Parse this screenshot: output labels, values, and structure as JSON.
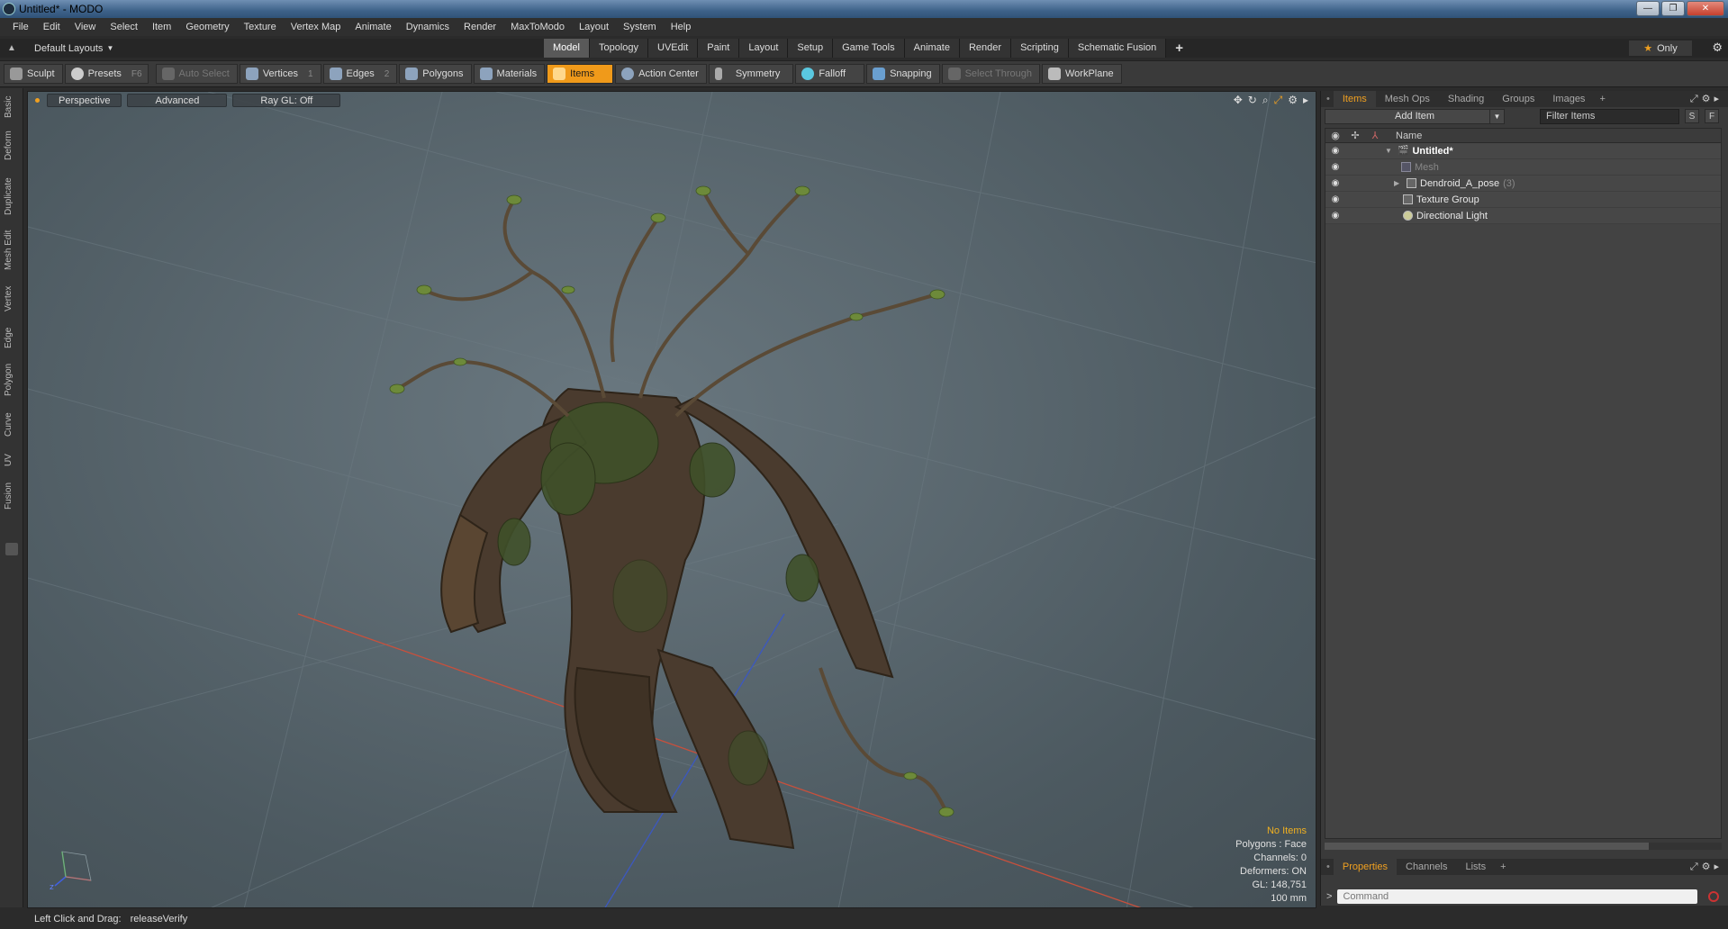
{
  "window": {
    "title": "Untitled* - MODO",
    "controls": [
      "—",
      "❐",
      "✕"
    ]
  },
  "menu": [
    "File",
    "Edit",
    "View",
    "Select",
    "Item",
    "Geometry",
    "Texture",
    "Vertex Map",
    "Animate",
    "Dynamics",
    "Render",
    "MaxToModo",
    "Layout",
    "System",
    "Help"
  ],
  "layout_selector": {
    "label": "Default Layouts"
  },
  "mode_tabs": [
    {
      "label": "Model",
      "active": true
    },
    {
      "label": "Topology"
    },
    {
      "label": "UVEdit"
    },
    {
      "label": "Paint"
    },
    {
      "label": "Layout"
    },
    {
      "label": "Setup"
    },
    {
      "label": "Game Tools"
    },
    {
      "label": "Animate"
    },
    {
      "label": "Render"
    },
    {
      "label": "Scripting"
    },
    {
      "label": "Schematic Fusion"
    }
  ],
  "mode_tabs_plus": "+",
  "only_button": {
    "star": "★",
    "label": "Only"
  },
  "toolbar": {
    "sculpt": "Sculpt",
    "presets": "Presets",
    "presets_hotkey": "F6",
    "auto_select": "Auto Select",
    "vertices": "Vertices",
    "vertices_hotkey": "1",
    "edges": "Edges",
    "edges_hotkey": "2",
    "polygons": "Polygons",
    "materials": "Materials",
    "items": "Items",
    "action_center": "Action Center",
    "symmetry": "Symmetry",
    "falloff": "Falloff",
    "snapping": "Snapping",
    "select_through": "Select Through",
    "workplane": "WorkPlane"
  },
  "left_tabs": [
    "Basic",
    "Deform",
    "Duplicate",
    "Mesh Edit",
    "Vertex",
    "Edge",
    "Polygon",
    "Curve",
    "UV",
    "Fusion"
  ],
  "viewport": {
    "view": "Perspective",
    "style": "Advanced",
    "raygl": "Ray GL: Off",
    "info": {
      "no_items": "No Items",
      "polygons": "Polygons : Face",
      "channels": "Channels: 0",
      "deformers": "Deformers: ON",
      "gl": "GL: 148,751",
      "scale": "100 mm"
    }
  },
  "statusbar": {
    "hint": "Left Click and Drag:",
    "action": "releaseVerify"
  },
  "items_panel": {
    "tabs": [
      "Items",
      "Mesh Ops",
      "Shading",
      "Groups",
      "Images"
    ],
    "add_item": "Add Item",
    "filter_placeholder": "Filter Items",
    "s_btn": "S",
    "f_btn": "F",
    "column_name": "Name",
    "rows": [
      {
        "name": "Untitled*",
        "expander": "▼",
        "type": "scene"
      },
      {
        "name": "Mesh",
        "expander": "",
        "type": "mesh"
      },
      {
        "name": "Dendroid_A_pose",
        "count": "(3)",
        "expander": "▶",
        "type": "locator"
      },
      {
        "name": "Texture Group",
        "expander": "",
        "type": "group"
      },
      {
        "name": "Directional Light",
        "expander": "",
        "type": "light"
      }
    ]
  },
  "properties_panel": {
    "tabs": [
      "Properties",
      "Channels",
      "Lists"
    ],
    "command_placeholder": "Command",
    "prompt": ">"
  },
  "colors": {
    "accent": "#f09a1a",
    "viewport_bg": "#56646b",
    "panel_bg": "#3a3a3a",
    "grid_x_axis": "#c8503c",
    "grid_z_axis": "#3c58c0"
  }
}
